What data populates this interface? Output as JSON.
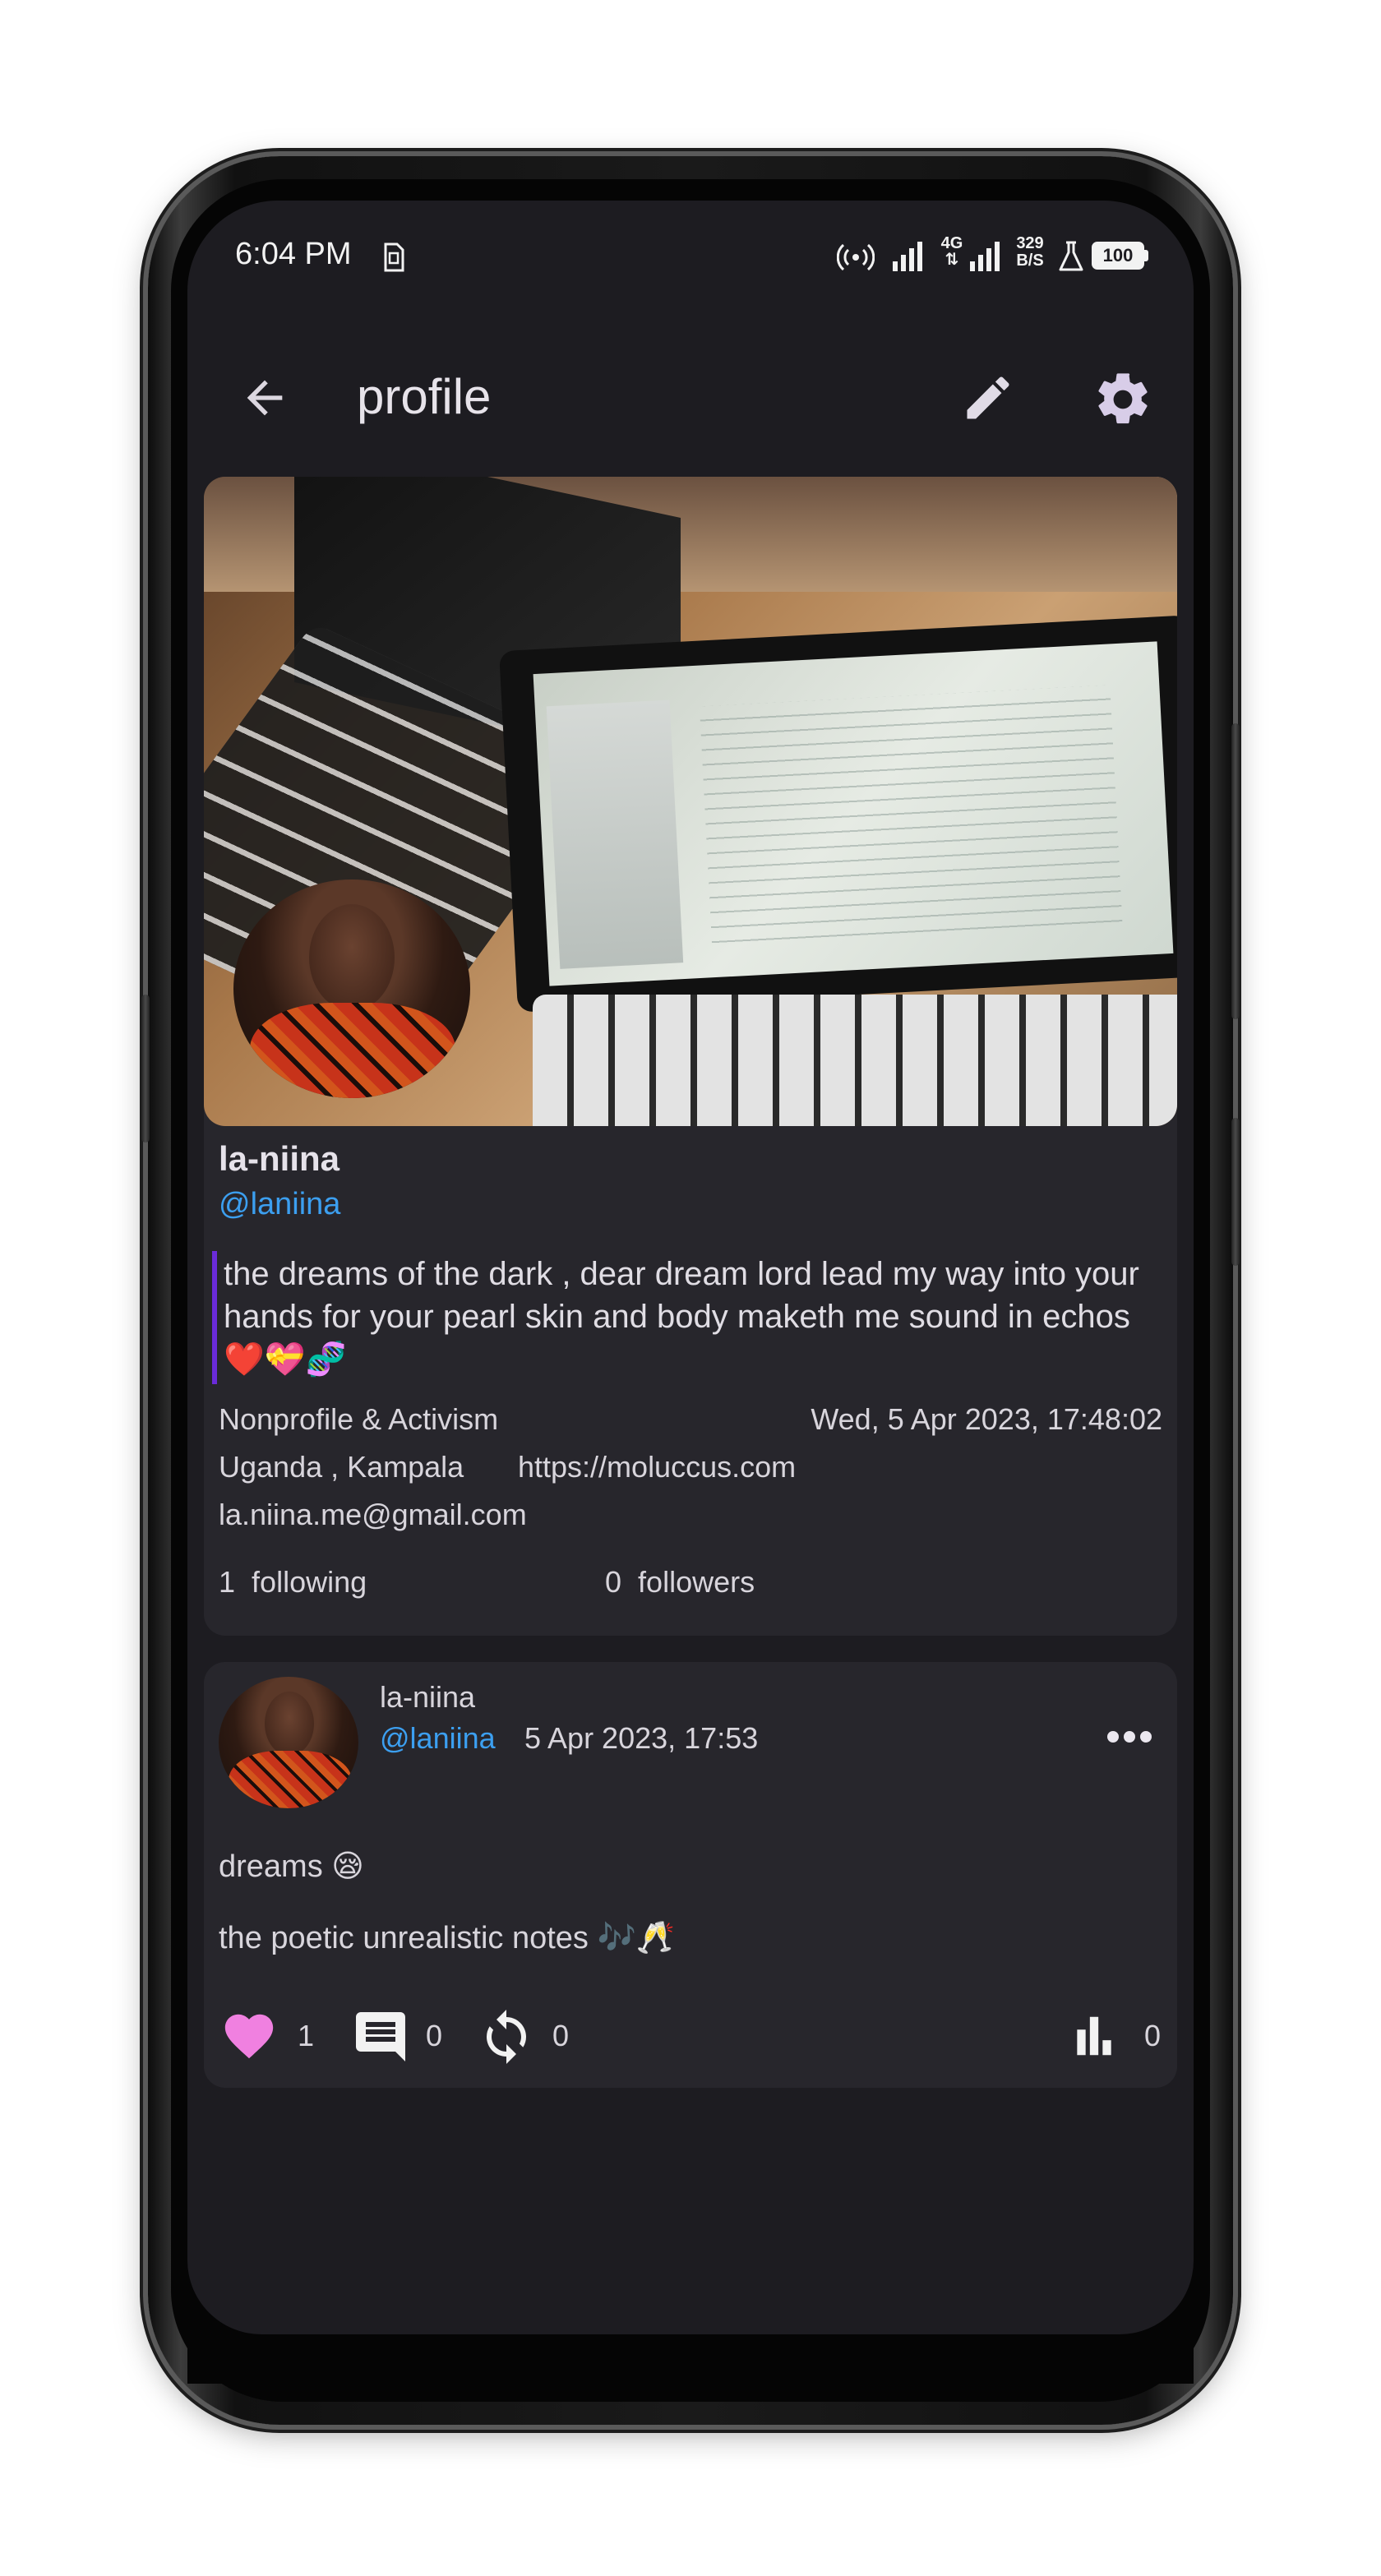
{
  "status_bar": {
    "time": "6:04 PM",
    "net_speed_value": "329",
    "net_speed_unit": "B/S",
    "battery": "100"
  },
  "app_bar": {
    "title": "profile",
    "back_icon": "arrow-left-icon",
    "edit_icon": "pencil-icon",
    "settings_icon": "gear-icon"
  },
  "profile": {
    "display_name": "la-niina",
    "handle": "@laniina",
    "bio": "the dreams of the dark , dear dream lord lead my way into your hands for your pearl skin and body maketh me sound in echos ❤️💝🧬",
    "category": "Nonprofile & Activism",
    "joined": "Wed, 5 Apr 2023, 17:48:02",
    "location": "Uganda , Kampala",
    "website": "https://moluccus.com",
    "email": "la.niina.me@gmail.com",
    "following_count": "1",
    "following_label": "following",
    "followers_count": "0",
    "followers_label": "followers"
  },
  "post": {
    "author_name": "la-niina",
    "author_handle": "@laniina",
    "timestamp": "5 Apr 2023, 17:53",
    "title": "dreams 😪",
    "body": "the poetic unrealistic notes 🎶🥂",
    "like_count": "1",
    "comment_count": "0",
    "repost_count": "0",
    "views_count": "0",
    "more_icon": "more-horizontal-icon"
  },
  "colors": {
    "screen_bg": "#1d1c21",
    "card_bg": "#27262c",
    "link": "#3c9ff0",
    "bio_accent": "#6a2bd9",
    "like": "#f080e0"
  }
}
